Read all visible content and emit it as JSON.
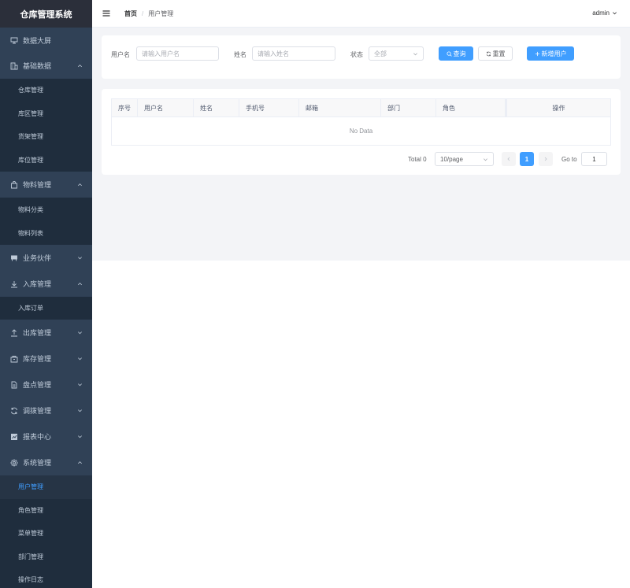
{
  "app": {
    "title": "仓库管理系统"
  },
  "header": {
    "breadcrumb": {
      "home": "首页",
      "separator": "/",
      "current": "用户管理"
    },
    "user": "admin"
  },
  "sidebar": {
    "items": [
      {
        "label": "数据大屏",
        "icon": "monitor-icon"
      },
      {
        "label": "基础数据",
        "icon": "building-icon",
        "expanded": true,
        "children": [
          "仓库管理",
          "库区管理",
          "货架管理",
          "库位管理"
        ]
      },
      {
        "label": "物料管理",
        "icon": "bag-icon",
        "expanded": true,
        "children": [
          "物料分类",
          "物料列表"
        ]
      },
      {
        "label": "业务伙伴",
        "icon": "partner-icon",
        "expanded": false
      },
      {
        "label": "入库管理",
        "icon": "download-icon",
        "expanded": true,
        "children": [
          "入库订单"
        ]
      },
      {
        "label": "出库管理",
        "icon": "upload-icon",
        "expanded": false
      },
      {
        "label": "库存管理",
        "icon": "box-icon",
        "expanded": false
      },
      {
        "label": "盘点管理",
        "icon": "document-icon",
        "expanded": false
      },
      {
        "label": "调拨管理",
        "icon": "refresh-icon",
        "expanded": false
      },
      {
        "label": "报表中心",
        "icon": "chart-icon",
        "expanded": false
      },
      {
        "label": "系统管理",
        "icon": "gear-icon",
        "expanded": true,
        "children": [
          "用户管理",
          "角色管理",
          "菜单管理",
          "部门管理",
          "操作日志"
        ]
      }
    ],
    "active": "用户管理"
  },
  "search": {
    "username_label": "用户名",
    "username_placeholder": "请输入用户名",
    "name_label": "姓名",
    "name_placeholder": "请输入姓名",
    "status_label": "状态",
    "status_value": "全部",
    "query_button": "查询",
    "reset_button": "重置",
    "add_button": "新增用户"
  },
  "table": {
    "columns": [
      "序号",
      "用户名",
      "姓名",
      "手机号",
      "邮箱",
      "部门",
      "角色",
      "操作"
    ],
    "empty_text": "No Data"
  },
  "pagination": {
    "total_label": "Total 0",
    "page_size": "10/page",
    "current_page": "1",
    "goto_label": "Go to",
    "goto_value": "1"
  },
  "colors": {
    "primary": "#409eff",
    "sidebar_bg": "#304156",
    "submenu_bg": "#1f2d3d"
  }
}
